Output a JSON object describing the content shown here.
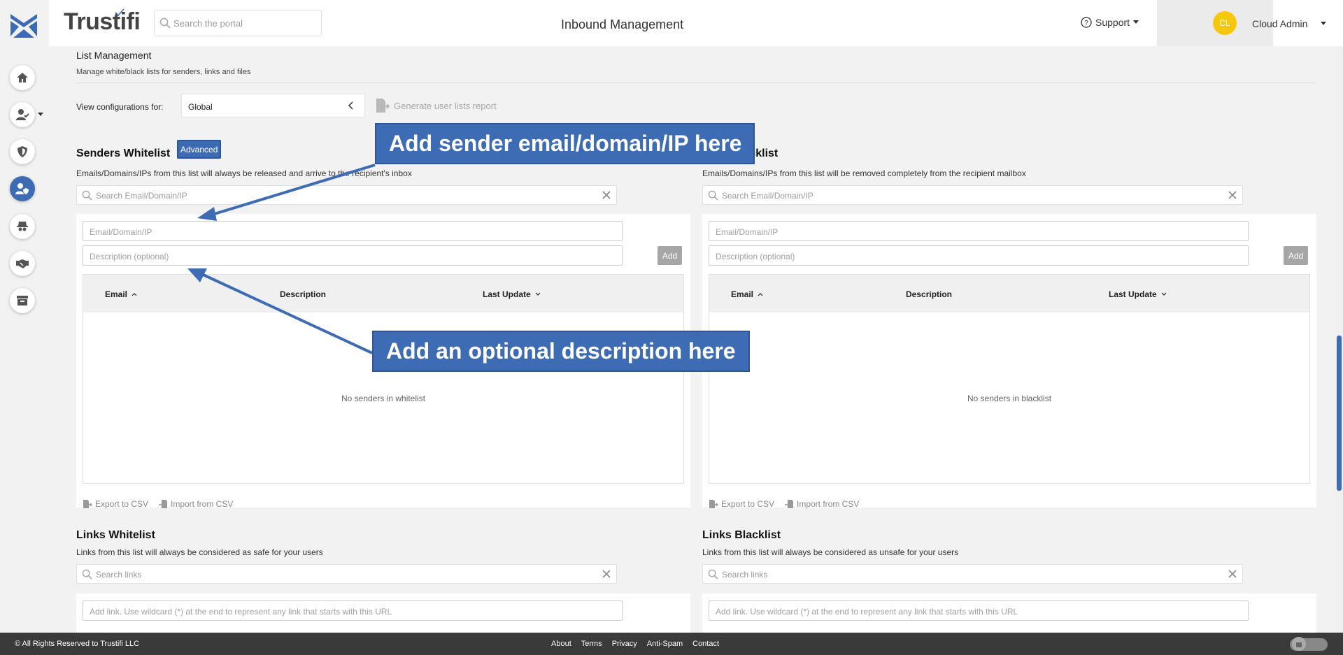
{
  "brand": {
    "name": "Trustifi"
  },
  "header": {
    "search_placeholder": "Search the portal",
    "page_title": "Inbound Management",
    "support_label": "Support",
    "user_initials": "CL",
    "user_name": "Cloud Admin"
  },
  "sidebar": {
    "items": [
      {
        "icon": "home-icon"
      },
      {
        "icon": "user-check-icon"
      },
      {
        "icon": "shield-icon"
      },
      {
        "icon": "user-shield-icon",
        "active": true
      },
      {
        "icon": "spy-icon"
      },
      {
        "icon": "handshake-icon"
      },
      {
        "icon": "archive-icon"
      }
    ]
  },
  "list_management": {
    "title": "List Management",
    "subtitle": "Manage white/black lists for senders, links and files",
    "view_label": "View configurations for:",
    "view_value": "Global",
    "generate_report": "Generate user lists report"
  },
  "senders_whitelist": {
    "title": "Senders Whitelist",
    "advanced_label": "Advanced",
    "description": "Emails/Domains/IPs from this list will always be released and arrive to the recipient's inbox",
    "search_placeholder": "Search Email/Domain/IP",
    "email_placeholder": "Email/Domain/IP",
    "desc_placeholder": "Description (optional)",
    "add_label": "Add",
    "columns": [
      "Email",
      "Description",
      "Last Update"
    ],
    "empty_text": "No senders in whitelist",
    "export_label": "Export to CSV",
    "import_label": "Import from CSV"
  },
  "senders_blacklist": {
    "title": "Senders Blacklist",
    "title_visible": "lacklist",
    "description": "Emails/Domains/IPs from this list will be removed completely from the recipient mailbox",
    "search_placeholder": "Search Email/Domain/IP",
    "email_placeholder": "Email/Domain/IP",
    "desc_placeholder": "Description (optional)",
    "add_label": "Add",
    "columns": [
      "Email",
      "Description",
      "Last Update"
    ],
    "empty_text": "No senders in blacklist",
    "export_label": "Export to CSV",
    "import_label": "Import from CSV"
  },
  "links_whitelist": {
    "title": "Links Whitelist",
    "description": "Links from this list will always be considered as safe for your users",
    "search_placeholder": "Search links",
    "link_placeholder": "Add link. Use wildcard (*) at the end to represent any link that starts with this URL"
  },
  "links_blacklist": {
    "title": "Links Blacklist",
    "description": "Links from this list will always be considered as unsafe for your users",
    "search_placeholder": "Search links",
    "link_placeholder": "Add link. Use wildcard (*) at the end to represent any link that starts with this URL"
  },
  "callouts": {
    "sender": "Add sender email/domain/IP here",
    "description": "Add an optional description here"
  },
  "footer": {
    "copyright": "© All Rights Reserved to Trustifi LLC",
    "links": [
      "About",
      "Terms",
      "Privacy",
      "Anti-Spam",
      "Contact"
    ]
  },
  "colors": {
    "accent": "#3e6cb4",
    "avatar": "#f5c70f",
    "footer": "#3a3a3a"
  }
}
